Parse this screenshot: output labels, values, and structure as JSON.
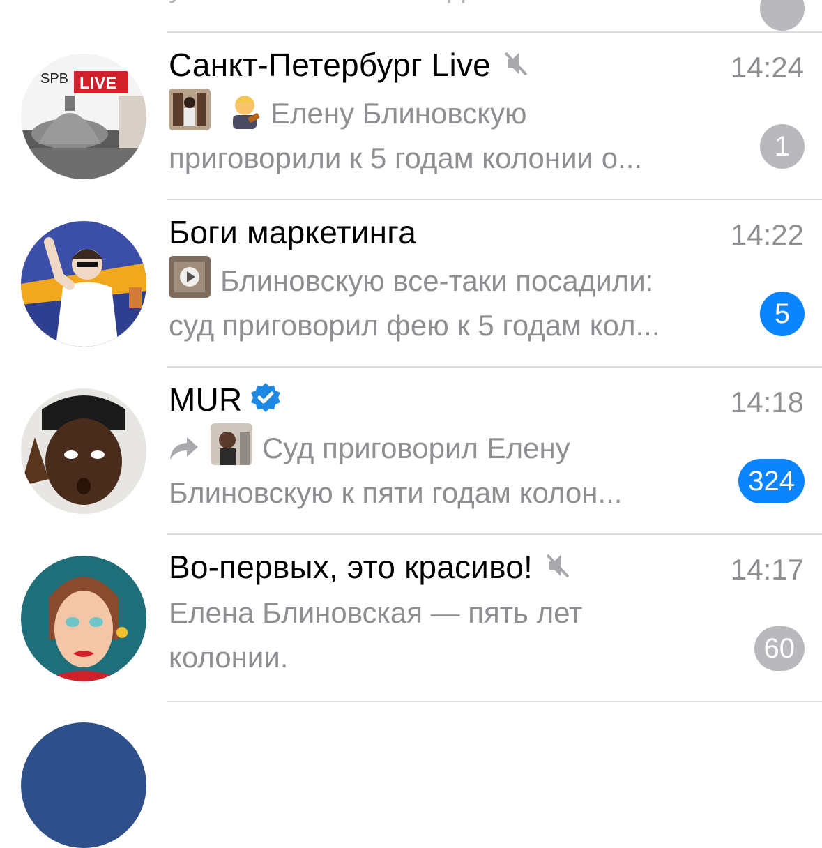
{
  "partial_top": {
    "preview": "ужасно и наказание должно быть..."
  },
  "chats": [
    {
      "title": "Санкт-Петербург Live",
      "time": "14:24",
      "muted": true,
      "verified": false,
      "preview_line1": "Елену Блиновскую",
      "preview_line2": "приговорили к 5 годам колонии о...",
      "unread": "1",
      "badge_color": "grey",
      "avatar": {
        "top_left_text": "SPB",
        "badge_text": "LIVE"
      }
    },
    {
      "title": "Боги маркетинга",
      "time": "14:22",
      "muted": false,
      "verified": false,
      "preview_line1": "Блиновскую все-таки посадили:",
      "preview_line2": "суд приговорил фею к 5 годам кол...",
      "unread": "5",
      "badge_color": "blue"
    },
    {
      "title": "MUR",
      "time": "14:18",
      "muted": false,
      "verified": true,
      "preview_line1": "Суд приговорил Елену",
      "preview_line2": "Блиновскую к пяти годам колон...",
      "unread": "324",
      "badge_color": "blue"
    },
    {
      "title": "Во-первых, это красиво!",
      "time": "14:17",
      "muted": true,
      "verified": false,
      "preview_line1": "Елена Блиновская — пять лет",
      "preview_line2": "колонии.",
      "unread": "60",
      "badge_color": "grey"
    }
  ],
  "colors": {
    "accent_blue": "#0a84ff",
    "muted_grey": "#b8b8bd",
    "secondary_text": "#8e8e93",
    "separator": "#dcdce0"
  }
}
